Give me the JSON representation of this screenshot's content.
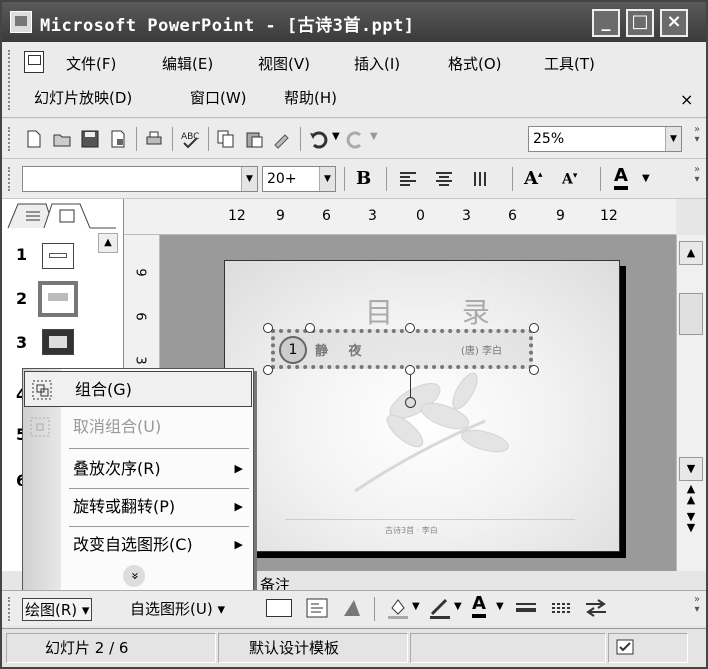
{
  "window": {
    "title": "Microsoft PowerPoint - [古诗3首.ppt]",
    "buttons": {
      "minimize": "_",
      "maximize": "□",
      "close": "×"
    }
  },
  "menubar": {
    "row1": [
      "文件(F)",
      "编辑(E)",
      "视图(V)",
      "插入(I)",
      "格式(O)",
      "工具(T)"
    ],
    "row2": [
      "幻灯片放映(D)",
      "窗口(W)",
      "帮助(H)"
    ],
    "close": "×"
  },
  "toolbar_standard": {
    "zoom": "25%"
  },
  "toolbar_format": {
    "font_name": "",
    "font_size": "20+",
    "bold": "B",
    "font_color": "A"
  },
  "ruler": {
    "horizontal": [
      "12",
      "9",
      "6",
      "3",
      "0",
      "3",
      "6",
      "9",
      "12"
    ],
    "vertical": [
      "9",
      "6",
      "3"
    ]
  },
  "slides_pane": {
    "numbers": [
      "1",
      "2",
      "3",
      "4",
      "5",
      "6"
    ],
    "selected": 2
  },
  "slide": {
    "title": "目 录",
    "item_left": "静 夜",
    "item_right": "(唐) 李白",
    "footer": "古诗3首 · 李白"
  },
  "context_menu": {
    "items": [
      {
        "label": "组合(G)",
        "submenu": false,
        "enabled": true,
        "highlighted": true
      },
      {
        "label": "取消组合(U)",
        "submenu": false,
        "enabled": false
      },
      {
        "label": "叠放次序(R)",
        "submenu": true,
        "enabled": true
      },
      {
        "label": "旋转或翻转(P)",
        "submenu": true,
        "enabled": true
      },
      {
        "label": "改变自选图形(C)",
        "submenu": true,
        "enabled": true
      }
    ],
    "more": "»"
  },
  "notes_label": "备注",
  "drawing_toolbar": {
    "draw": "绘图(R)",
    "autoshapes": "自选图形(U)"
  },
  "statusbar": {
    "slide_position": "幻灯片 2 / 6",
    "design": "默认设计模板"
  },
  "colors": {
    "title_bar": "#4a4a4a",
    "canvas": "#9a9a9a",
    "selection": "#777777"
  }
}
